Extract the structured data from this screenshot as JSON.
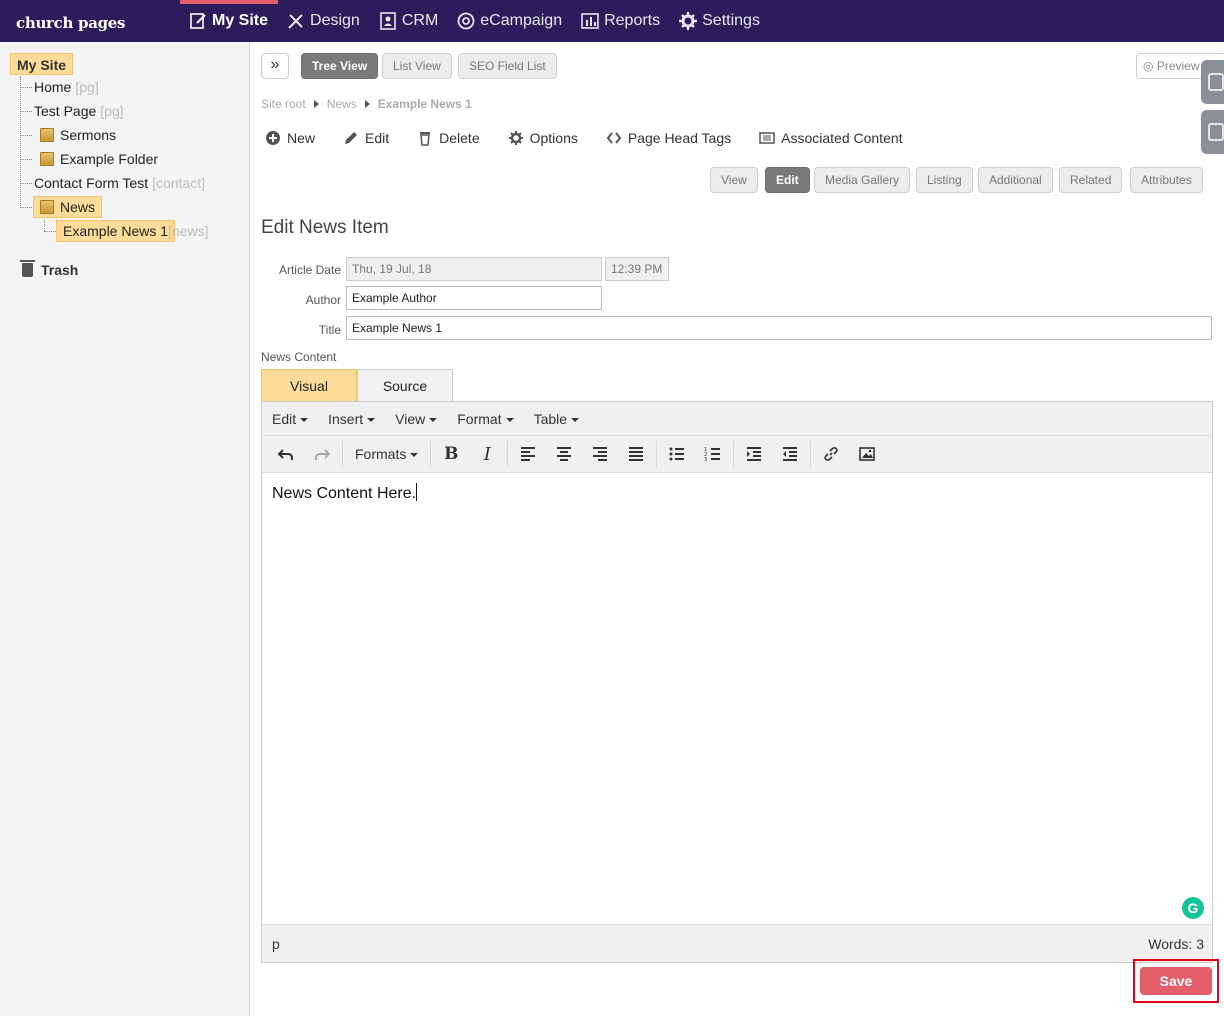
{
  "app": {
    "logo": "church pages"
  },
  "nav": [
    {
      "label": "My Site",
      "icon": "edit-page-icon",
      "active": true
    },
    {
      "label": "Design",
      "icon": "design-tools-icon"
    },
    {
      "label": "CRM",
      "icon": "contacts-icon"
    },
    {
      "label": "eCampaign",
      "icon": "at-sign-icon"
    },
    {
      "label": "Reports",
      "icon": "bar-chart-icon"
    },
    {
      "label": "Settings",
      "icon": "gear-icon"
    }
  ],
  "sidebar": {
    "root": "My Site",
    "items": [
      {
        "label": "Home",
        "tag": "[pg]"
      },
      {
        "label": "Test Page",
        "tag": "[pg]"
      },
      {
        "label": "Sermons",
        "tag": ""
      },
      {
        "label": "Example Folder",
        "tag": ""
      },
      {
        "label": "Contact Form Test",
        "tag": "[contact]"
      },
      {
        "label": "News",
        "tag": ""
      },
      {
        "label": "Example News 1",
        "tag": "[news]"
      }
    ],
    "trash": "Trash"
  },
  "views": {
    "tree": "Tree View",
    "list": "List View",
    "seo": "SEO Field List",
    "preview": "Preview"
  },
  "breadcrumb": {
    "root": "Site root",
    "parent": "News",
    "current": "Example News 1"
  },
  "actions": {
    "new": "New",
    "edit": "Edit",
    "delete": "Delete",
    "options": "Options",
    "head_tags": "Page Head Tags",
    "associated": "Associated Content"
  },
  "subtabs": [
    "View",
    "Edit",
    "Media Gallery",
    "Listing",
    "Additional",
    "Related",
    "Attributes"
  ],
  "form": {
    "title": "Edit News Item",
    "article_date_label": "Article Date",
    "article_date": "Thu, 19 Jul, 18",
    "article_time": "12:39 PM",
    "author_label": "Author",
    "author": "Example Author",
    "title_label": "Title",
    "title_value": "Example News 1",
    "content_label": "News Content"
  },
  "editor": {
    "tabs": {
      "visual": "Visual",
      "source": "Source"
    },
    "menus": [
      "Edit",
      "Insert",
      "View",
      "Format",
      "Table"
    ],
    "formats": "Formats",
    "content": "News Content Here.",
    "path": "p",
    "words": "Words: 3",
    "grammarly": "G"
  },
  "save": "Save"
}
